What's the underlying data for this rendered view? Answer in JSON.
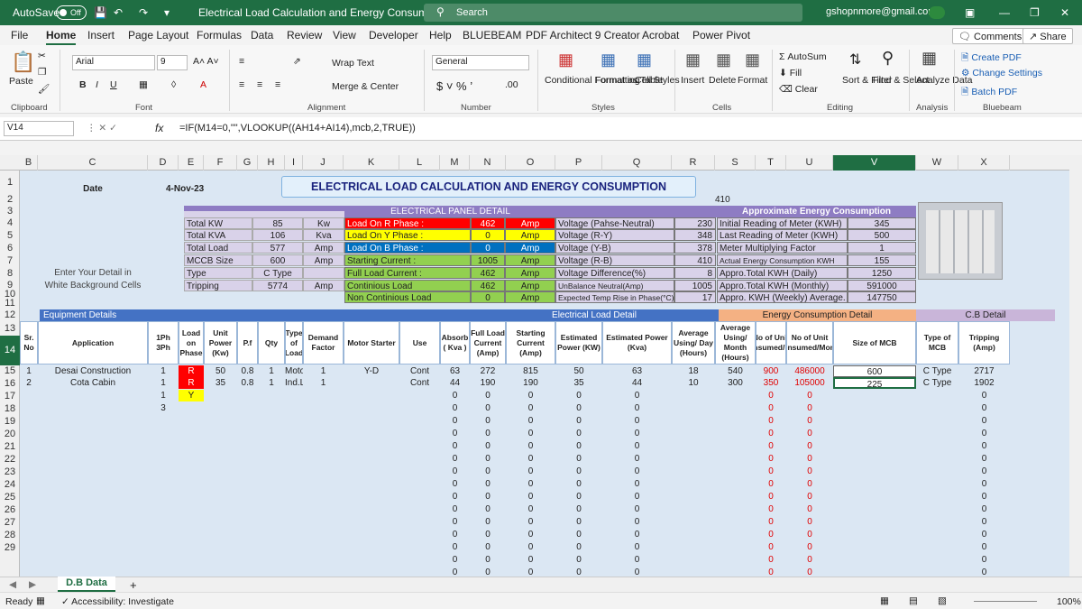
{
  "titlebar": {
    "autosave": "AutoSave",
    "toggle": "Off",
    "doc_title": "Electrical Load Calculation and Energy Consumption",
    "search": "Search",
    "user": "gshopnmore@gmail.com"
  },
  "menu": [
    "File",
    "Home",
    "Insert",
    "Page Layout",
    "Formulas",
    "Data",
    "Review",
    "View",
    "Developer",
    "Help",
    "BLUEBEAM",
    "PDF Architect 9 Creator",
    "Acrobat",
    "Power Pivot"
  ],
  "menu_right": {
    "comments": "Comments",
    "share": "Share"
  },
  "ribbon": {
    "font_name": "Arial",
    "font_size": "9",
    "wrap_text": "Wrap Text",
    "merge_center": "Merge & Center",
    "number_format": "General",
    "paste": "Paste",
    "cond_format": "Conditional Formatting",
    "format_table": "Format as Table",
    "cell_styles": "Cell Styles",
    "insert": "Insert",
    "delete": "Delete",
    "format": "Format",
    "autosum": "AutoSum",
    "fill": "Fill",
    "clear": "Clear",
    "sort_filter": "Sort & Filter",
    "find_select": "Find & Select",
    "analyze": "Analyze Data",
    "create_pdf": "Create PDF",
    "change_settings": "Change Settings",
    "batch_pdf": "Batch PDF",
    "groups": [
      "Clipboard",
      "Font",
      "Alignment",
      "Number",
      "Styles",
      "Cells",
      "Editing",
      "Analysis",
      "Bluebeam"
    ]
  },
  "formula_bar": {
    "name_box": "V14",
    "fx": "fx",
    "formula": "=IF(M14=0,\"\",VLOOKUP((AH14+AI14),mcb,2,TRUE))"
  },
  "columns": [
    "B",
    "C",
    "D",
    "E",
    "F",
    "G",
    "H",
    "I",
    "J",
    "K",
    "L",
    "M",
    "N",
    "O",
    "P",
    "Q",
    "R",
    "S",
    "T",
    "U",
    "V",
    "W",
    "X"
  ],
  "rows": [
    "1",
    "2",
    "3",
    "4",
    "5",
    "6",
    "7",
    "8",
    "9",
    "10",
    "11",
    "12",
    "13",
    "14",
    "15",
    "16",
    "17",
    "18",
    "19",
    "20",
    "21",
    "22",
    "23",
    "24",
    "25",
    "26",
    "27",
    "28",
    "29"
  ],
  "sheet": {
    "date_label": "Date",
    "date_value": "4-Nov-23",
    "main_title": "ELECTRICAL LOAD CALCULATION AND ENERGY CONSUMPTION",
    "r410": "410",
    "panel_title": "ELECTRICAL PANEL DETAIL",
    "energy_title": "Approximate Energy Consumption",
    "enter_detail": "Enter Your Detail in",
    "white_bg": "White Background Cells",
    "left_block": [
      [
        "Total KW",
        "85",
        "Kw"
      ],
      [
        "Total KVA",
        "106",
        "Kva"
      ],
      [
        "Total Load",
        "577",
        "Amp"
      ],
      [
        "MCCB Size",
        "600",
        "Amp"
      ],
      [
        "Type",
        "C Type",
        ""
      ],
      [
        "Tripping",
        "5774",
        "Amp"
      ]
    ],
    "phase_block": [
      [
        "Load On R Phase :",
        "462",
        "Amp"
      ],
      [
        "Load On Y Phase :",
        "0",
        "Amp"
      ],
      [
        "Load On B Phase :",
        "0",
        "Amp"
      ],
      [
        "Starting Current  :",
        "1005",
        "Amp"
      ],
      [
        "Full Load Current :",
        "462",
        "Amp"
      ],
      [
        "Continious Load",
        "462",
        "Amp"
      ],
      [
        "Non Continious Load",
        "0",
        "Amp"
      ]
    ],
    "voltage_block": [
      [
        "Voltage (Pahse-Neutral)",
        "230"
      ],
      [
        "Voltage (R-Y)",
        "348"
      ],
      [
        "Voltage (Y-B)",
        "378"
      ],
      [
        "Voltage (R-B)",
        "410"
      ],
      [
        "Voltage Difference(%)",
        "8"
      ],
      [
        "UnBalance Neutral(Amp)",
        "1005"
      ],
      [
        "Expected Temp Rise in Phase(°C)",
        "17"
      ]
    ],
    "energy_block": [
      [
        "Initial Reading of Meter (KWH)",
        "345"
      ],
      [
        "Last Reading of Meter (KWH)",
        "500"
      ],
      [
        "Meter Multiplying Factor",
        "1"
      ],
      [
        "Actual Energy Consumption KWH",
        "155"
      ],
      [
        "Appro.Total KWH (Daily)",
        "1250"
      ],
      [
        "Appro.Total KWH (Monthly)",
        "591000"
      ],
      [
        "Appro. KWH (Weekly) Average.",
        "147750"
      ]
    ],
    "sec_equipment": "Equipment Details",
    "sec_electrical": "Electrical Load Detail",
    "sec_energy": "Energy Consumption Detail",
    "sec_cb": "C.B Detail",
    "headers": [
      "Sr. No",
      "Application",
      "1Ph 3Ph",
      "Load on Phase",
      "Unit Power (Kw)",
      "P.f",
      "Qty",
      "Type of Load",
      "Demand Factor",
      "Motor Starter",
      "Use",
      "Absorb ( Kva )",
      "Full Load Current (Amp)",
      "Starting Current (Amp)",
      "Estimated Power (KW)",
      "Estimated Power (Kva)",
      "Average Using/ Day (Hours)",
      "Average Using/ Month (Hours)",
      "No of Unit Consumed/Day",
      "No of Unit Consumed/Month",
      "Size of MCB",
      "Type of MCB",
      "Tripping (Amp)"
    ],
    "data_rows": [
      [
        "1",
        "Desai Construction",
        "1",
        "R",
        "50",
        "0.8",
        "1",
        "Motor",
        "1",
        "Y-D",
        "Cont",
        "63",
        "272",
        "815",
        "50",
        "63",
        "18",
        "540",
        "900",
        "486000",
        "600",
        "C Type",
        "2717"
      ],
      [
        "2",
        "Cota Cabin",
        "1",
        "R",
        "35",
        "0.8",
        "1",
        "Ind.Load",
        "1",
        "",
        "Cont",
        "44",
        "190",
        "190",
        "35",
        "44",
        "10",
        "300",
        "350",
        "105000",
        "225",
        "C Type",
        "1902"
      ]
    ],
    "row15_ph": "1",
    "row15_load": "Y",
    "row16_ph": "3",
    "zero": "0"
  },
  "tabs": {
    "sheet": "D.B Data",
    "add": "+"
  },
  "status": {
    "ready": "Ready",
    "accessibility": "Accessibility: Investigate",
    "zoom": "100%"
  },
  "colors": {
    "accent": "#1f6e43",
    "phase_r": "#ff0000",
    "phase_y": "#ffff00",
    "phase_b": "#0070c0",
    "green": "#92d050",
    "panel": "#8e7cc3",
    "lavender": "#d9d2e9",
    "header_blue": "#4472c4",
    "energy_orange": "#f4b183"
  }
}
